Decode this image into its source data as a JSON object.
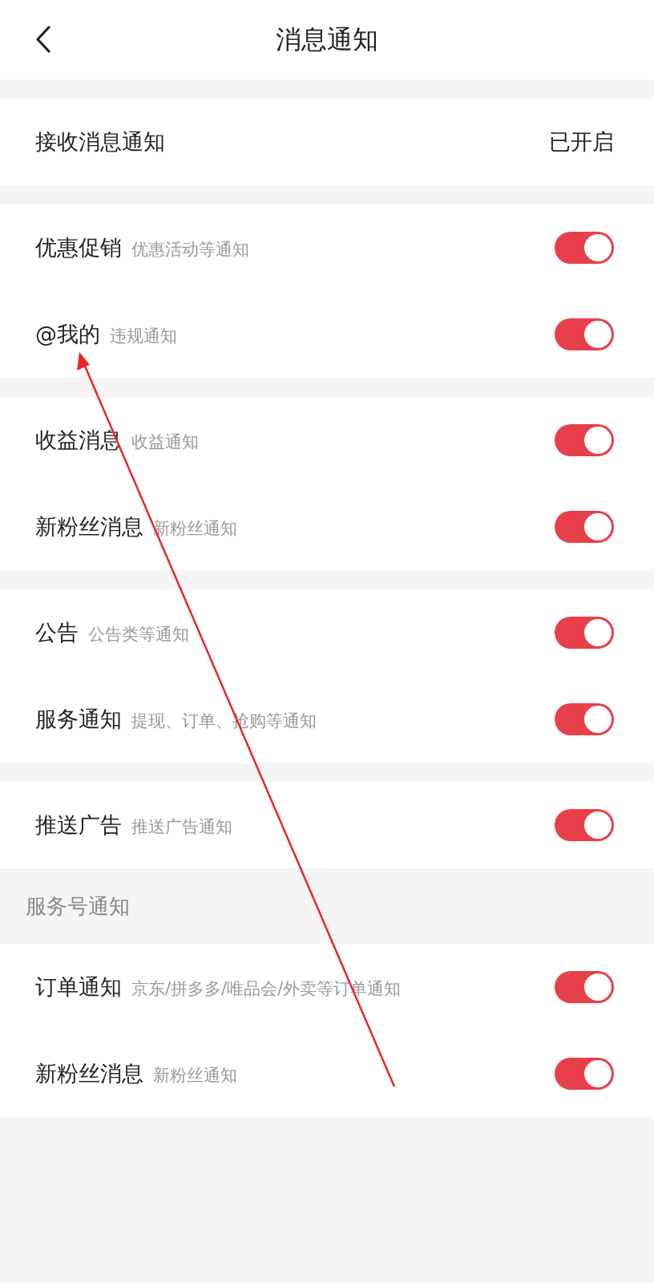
{
  "header": {
    "title": "消息通知"
  },
  "master": {
    "label": "接收消息通知",
    "value": "已开启"
  },
  "groups": [
    {
      "items": [
        {
          "title": "优惠促销",
          "desc": "优惠活动等通知",
          "on": true
        },
        {
          "title": "@我的",
          "desc": "违规通知",
          "on": true
        }
      ]
    },
    {
      "items": [
        {
          "title": "收益消息",
          "desc": "收益通知",
          "on": true
        },
        {
          "title": "新粉丝消息",
          "desc": "新粉丝通知",
          "on": true
        }
      ]
    },
    {
      "items": [
        {
          "title": "公告",
          "desc": "公告类等通知",
          "on": true
        },
        {
          "title": "服务通知",
          "desc": "提现、订单、抢购等通知",
          "on": true
        }
      ]
    },
    {
      "items": [
        {
          "title": "推送广告",
          "desc": "推送广告通知",
          "on": true
        }
      ]
    },
    {
      "heading": "服务号通知",
      "items": [
        {
          "title": "订单通知",
          "desc": "京东/拼多多/唯品会/外卖等订单通知",
          "on": true
        },
        {
          "title": "新粉丝消息",
          "desc": "新粉丝通知",
          "on": true
        }
      ]
    }
  ]
}
